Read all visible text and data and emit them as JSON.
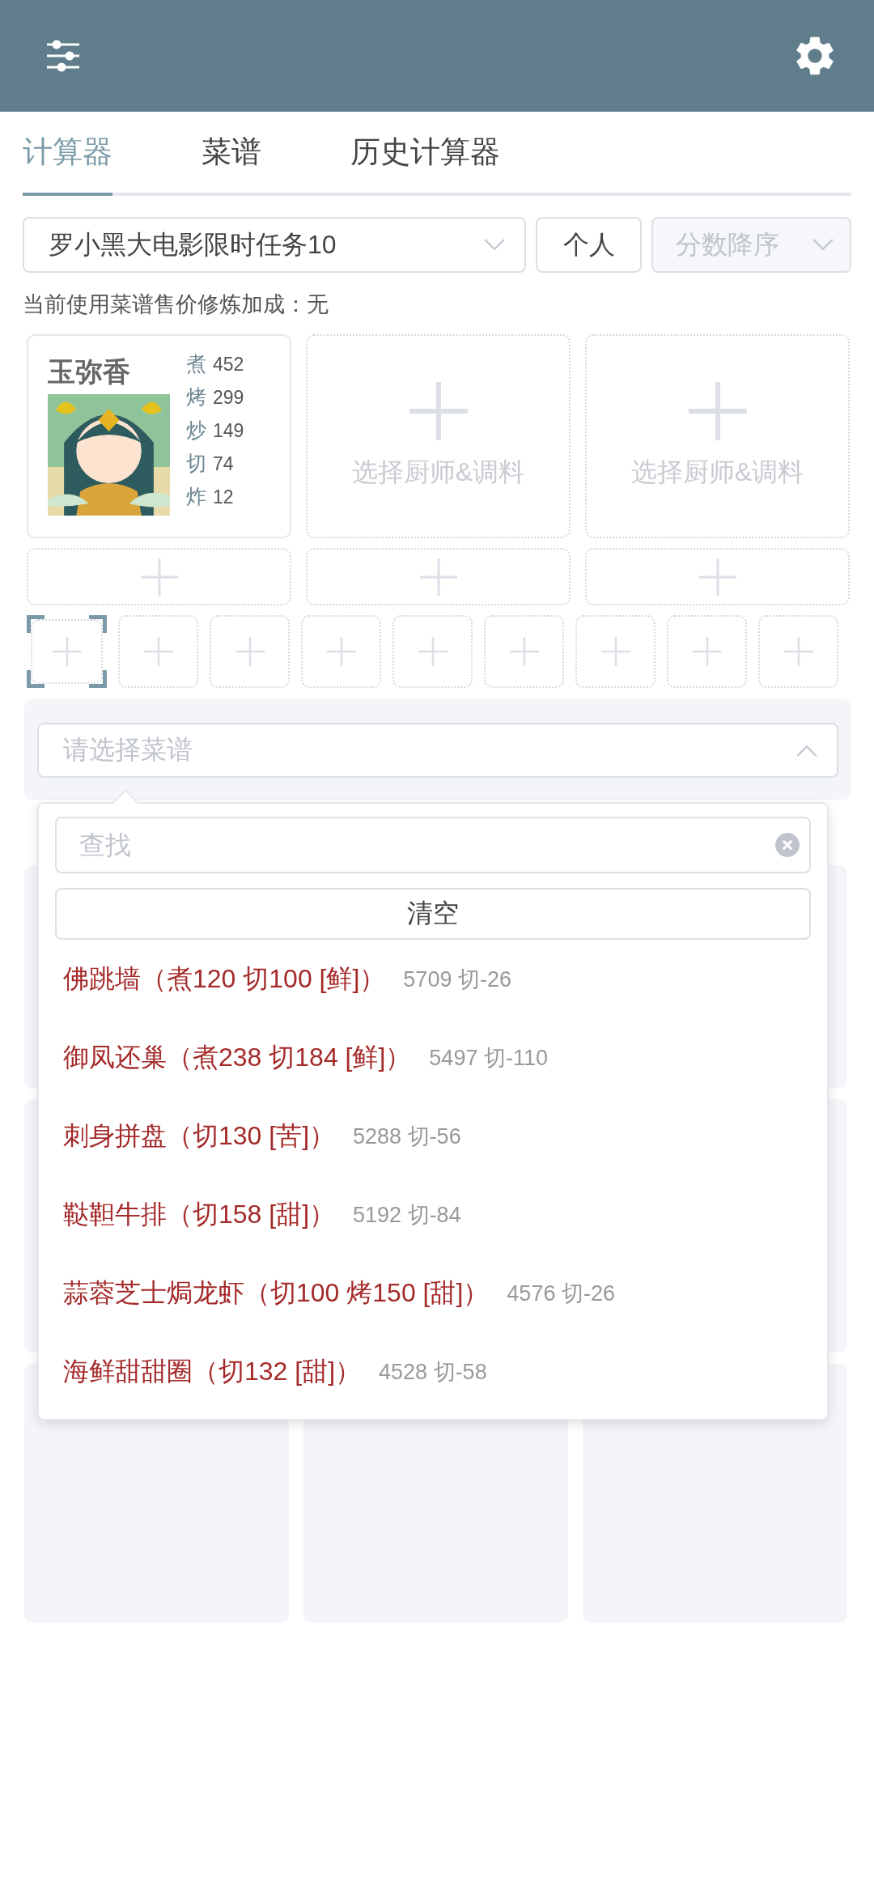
{
  "tabs": [
    {
      "label": "计算器",
      "selected": true
    },
    {
      "label": "菜谱",
      "selected": false
    },
    {
      "label": "历史计算器",
      "selected": false
    }
  ],
  "rule_select": {
    "value": "罗小黑大电影限时任务10"
  },
  "scope_button": "个人",
  "sort_select": {
    "value": "分数降序",
    "disabled": true
  },
  "bonus_note": "当前使用菜谱售价修炼加成：无",
  "chef_slots": [
    {
      "kind": "chef",
      "name": "玉弥香",
      "skills": [
        {
          "label": "煮",
          "value": "452"
        },
        {
          "label": "烤",
          "value": "299"
        },
        {
          "label": "炒",
          "value": "149"
        },
        {
          "label": "切",
          "value": "74"
        },
        {
          "label": "炸",
          "value": "12"
        }
      ]
    },
    {
      "kind": "empty",
      "label": "选择厨师&调料"
    },
    {
      "kind": "empty",
      "label": "选择厨师&调料"
    }
  ],
  "ingredient_slots": [
    {
      "selected": true
    },
    {
      "selected": false
    },
    {
      "selected": false
    },
    {
      "selected": false
    },
    {
      "selected": false
    },
    {
      "selected": false
    },
    {
      "selected": false
    },
    {
      "selected": false
    },
    {
      "selected": false
    }
  ],
  "recipe_select": {
    "placeholder": "请选择菜谱",
    "expanded": true
  },
  "recipe_dropdown": {
    "search": {
      "placeholder": "查找"
    },
    "clear_button": "清空",
    "options": [
      {
        "name": "佛跳墙（煮120 切100 [鲜]）",
        "score": "5709 切-26"
      },
      {
        "name": "御凤还巢（煮238 切184 [鲜]）",
        "score": "5497 切-110"
      },
      {
        "name": "刺身拼盘（切130 [苦]）",
        "score": "5288 切-56"
      },
      {
        "name": "鞑靼牛排（切158 [甜]）",
        "score": "5192 切-84"
      },
      {
        "name": "蒜蓉芝士焗龙虾（切100 烤150 [甜]）",
        "score": "4576 切-26"
      },
      {
        "name": "海鲜甜甜圈（切132 [甜]）",
        "score": "4528 切-58"
      }
    ]
  }
}
